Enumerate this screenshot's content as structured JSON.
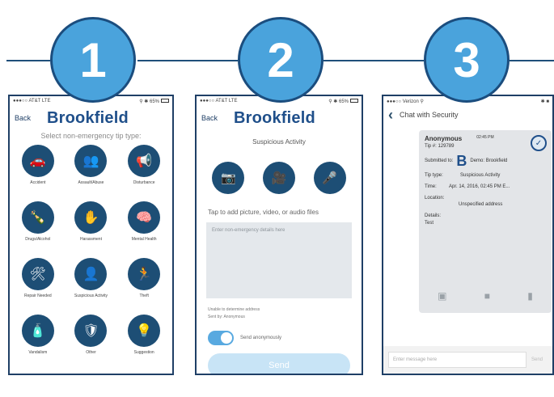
{
  "steps": [
    "1",
    "2",
    "3"
  ],
  "colors": {
    "accent": "#4aa3dc",
    "navy": "#1d4e75",
    "title": "#1f4f8a"
  },
  "panel1": {
    "status_left": "●●●○○ AT&T  LTE",
    "status_right": "⚲ ✱ 65%",
    "back": "Back",
    "title": "Brookfield",
    "subtitle": "Select non-emergency tip type:",
    "tip_types": [
      {
        "label": "Accident",
        "icon": "car-accident-icon",
        "glyph": "🚗"
      },
      {
        "label": "Assault/Abuse",
        "icon": "people-icon",
        "glyph": "👥"
      },
      {
        "label": "Disturbance",
        "icon": "disturbance-icon",
        "glyph": "📢"
      },
      {
        "label": "Drugs/Alcohol",
        "icon": "bottle-icon",
        "glyph": "🍾"
      },
      {
        "label": "Harassment",
        "icon": "hand-icon",
        "glyph": "✋"
      },
      {
        "label": "Mental Health",
        "icon": "head-icon",
        "glyph": "🧠"
      },
      {
        "label": "Repair Needed",
        "icon": "tools-icon",
        "glyph": "🛠"
      },
      {
        "label": "Suspicious Activity",
        "icon": "person-icon",
        "glyph": "👤"
      },
      {
        "label": "Theft",
        "icon": "running-icon",
        "glyph": "🏃"
      },
      {
        "label": "Vandalism",
        "icon": "spray-icon",
        "glyph": "🧴"
      },
      {
        "label": "Other",
        "icon": "shield-icon",
        "glyph": "🛡"
      },
      {
        "label": "Suggestion",
        "icon": "lightbulb-icon",
        "glyph": "💡"
      }
    ]
  },
  "panel2": {
    "status_left": "●●●○○ AT&T  LTE",
    "status_right": "⚲ ✱ 65%",
    "back": "Back",
    "title": "Brookfield",
    "subtitle": "Suspicious Activity",
    "media": [
      {
        "icon": "camera-icon",
        "glyph": "📷"
      },
      {
        "icon": "video-icon",
        "glyph": "🎥"
      },
      {
        "icon": "microphone-icon",
        "glyph": "🎤"
      }
    ],
    "tap_text": "Tap to add picture, video, or audio files",
    "details_placeholder": "Enter non-emergency details here",
    "address_note": "Unable to determine address",
    "sent_by": "Sent by: Anonymous",
    "toggle_label": "Send anonymously",
    "send_label": "Send"
  },
  "panel3": {
    "status_left": "●●●○○ Verizon ⚲",
    "status_right": "✱ ■",
    "chat_title": "Chat with Security",
    "sender": "Anonymous",
    "time": "02:45 PM",
    "tip_id": "Tip #:  129789",
    "submitted_label": "Submitted to:",
    "submitted_value": "Demo: Brookfield",
    "tip_type_label": "Tip type:",
    "tip_type_value": "Suspicious Activity",
    "time_label": "Time:",
    "time_value": "Apr. 14, 2016, 02:45 PM E...",
    "location_label": "Location:",
    "location_value": "Unspecified address",
    "details_label": "Details:",
    "details_value": "Test",
    "message_placeholder": "Enter message here",
    "send_label": "Send"
  }
}
